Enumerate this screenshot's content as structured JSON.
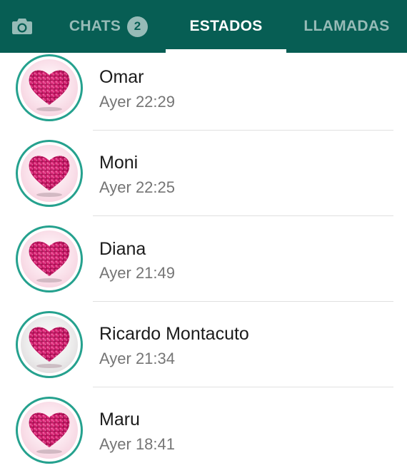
{
  "header": {
    "camera_icon": "camera-icon",
    "tabs": [
      {
        "label": "CHATS",
        "badge": "2",
        "active": false
      },
      {
        "label": "ESTADOS",
        "active": true
      },
      {
        "label": "LLAMADAS",
        "active": false
      }
    ],
    "colors": {
      "bar": "#075e54",
      "ring": "#25a18e"
    }
  },
  "statuses": [
    {
      "name": "Omar",
      "time": "Ayer 22:29",
      "avatar_icon": "pink-glitter-heart"
    },
    {
      "name": "Moni",
      "time": "Ayer 22:25",
      "avatar_icon": "pink-glitter-heart"
    },
    {
      "name": "Diana",
      "time": "Ayer 21:49",
      "avatar_icon": "pink-glitter-heart"
    },
    {
      "name": "Ricardo Montacuto",
      "time": "Ayer 21:34",
      "avatar_icon": "pink-glitter-heart"
    },
    {
      "name": "Maru",
      "time": "Ayer 18:41",
      "avatar_icon": "pink-glitter-heart"
    }
  ]
}
